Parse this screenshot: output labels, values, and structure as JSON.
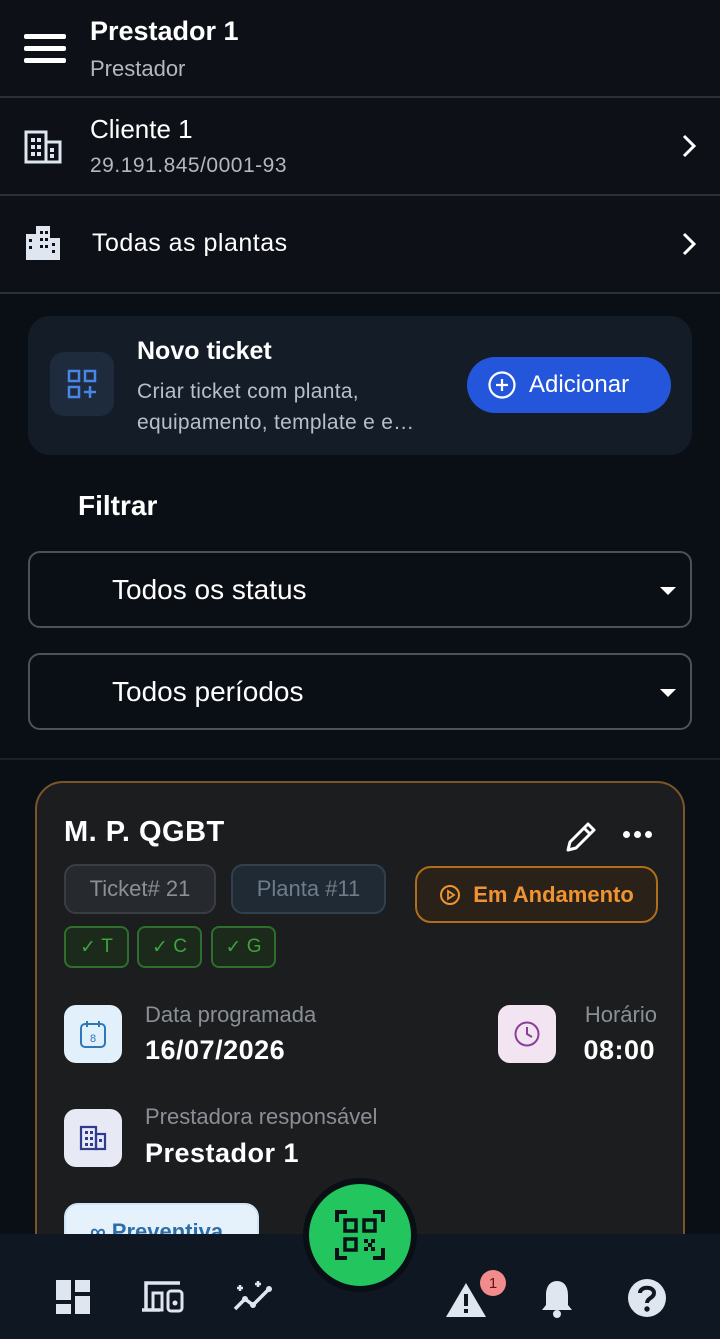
{
  "header": {
    "title": "Prestador 1",
    "subtitle": "Prestador"
  },
  "client": {
    "name": "Cliente 1",
    "cnpj": "29.191.845/0001-93"
  },
  "plants": {
    "label": "Todas as plantas"
  },
  "new_ticket": {
    "title": "Novo ticket",
    "description": "Criar ticket com planta, equipamento, template e e…",
    "button_label": "Adicionar"
  },
  "filter": {
    "title": "Filtrar",
    "status_select": "Todos os status",
    "period_select": "Todos períodos"
  },
  "ticket_card": {
    "title": "M. P. QGBT",
    "ticket_tag": "Ticket# 21",
    "planta_tag": "Planta #11",
    "status": "Em Andamento",
    "checks": [
      "T",
      "C",
      "G"
    ],
    "date_label": "Data programada",
    "date_value": "16/07/2026",
    "calendar_day": "8",
    "time_label": "Horário",
    "time_value": "08:00",
    "provider_label": "Prestadora responsável",
    "provider_value": "Prestador 1",
    "type_chip": "Preventiva"
  },
  "bottom_nav": {
    "alerts_badge": "1"
  },
  "colors": {
    "accent_blue": "#2456dc",
    "status_orange": "#f09432",
    "fab_green": "#22c55e",
    "check_green": "#3da43d"
  }
}
